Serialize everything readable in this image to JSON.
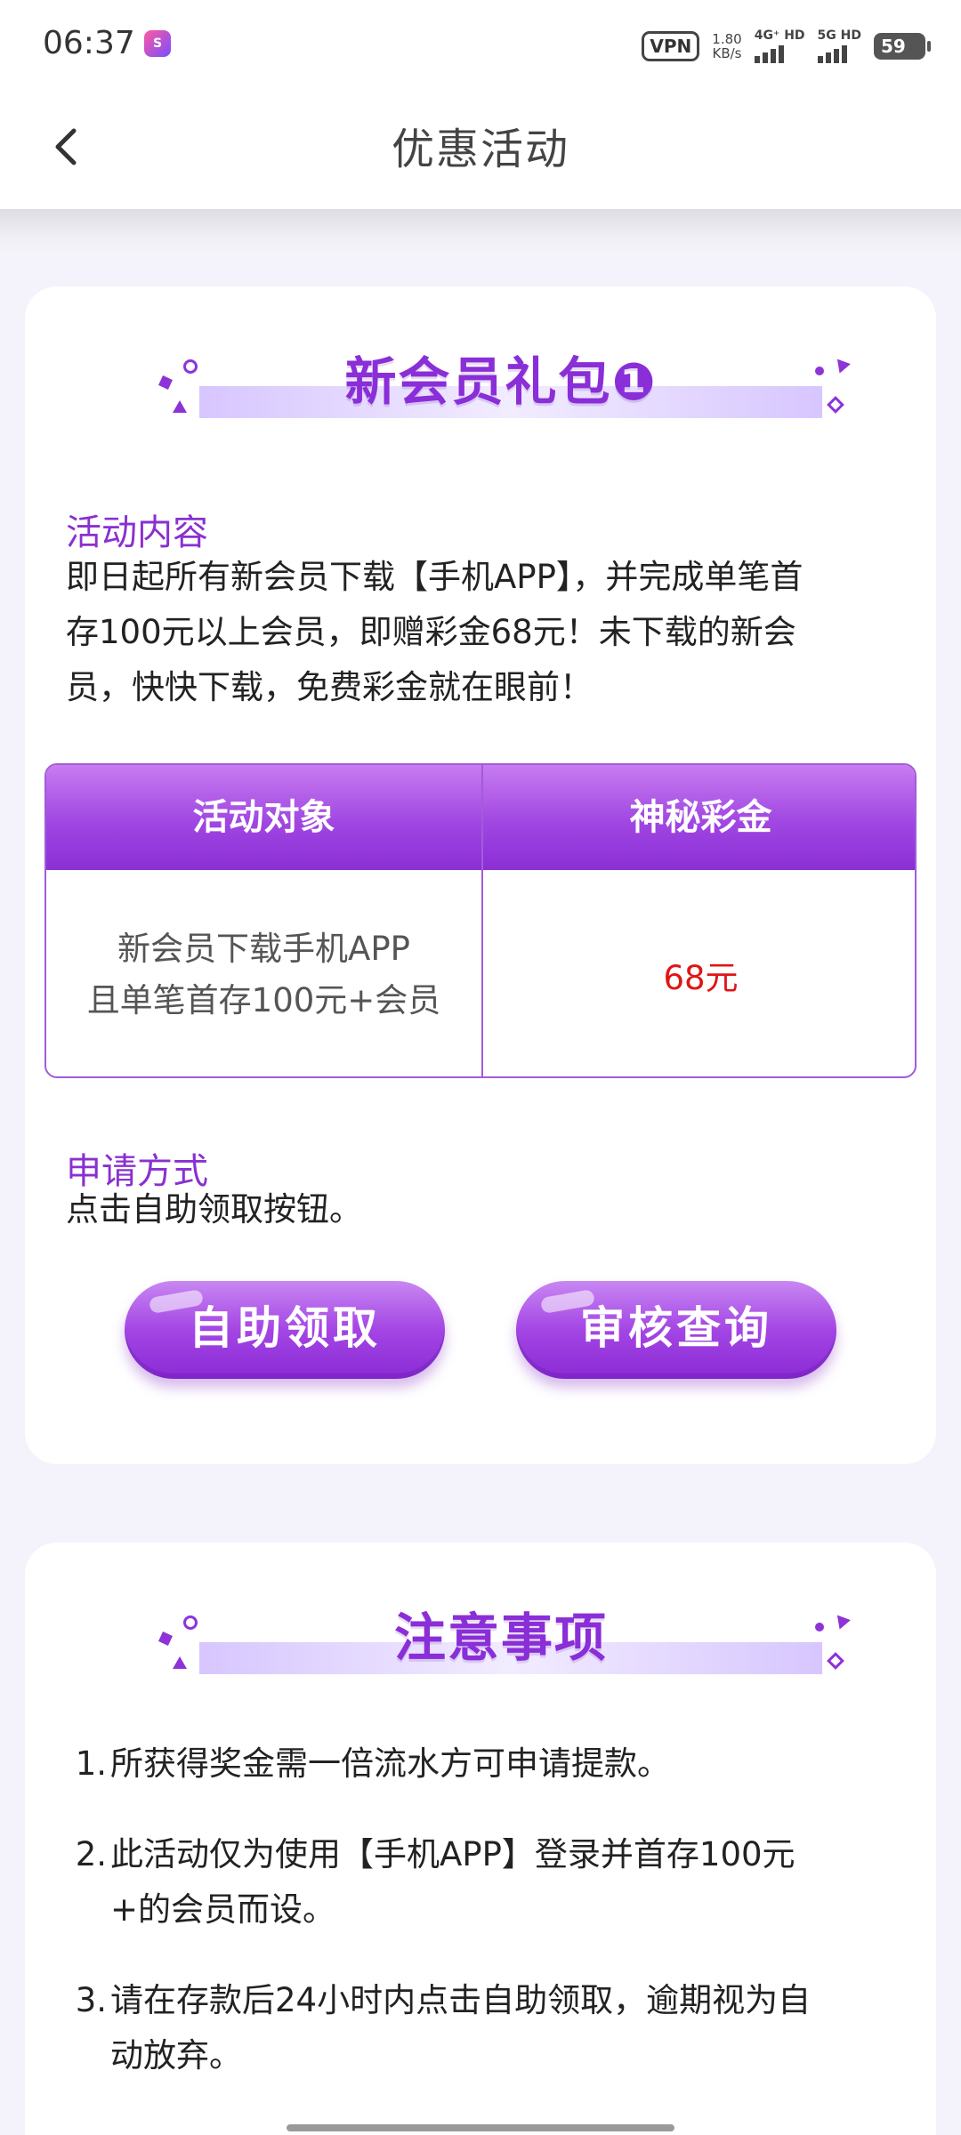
{
  "status_bar": {
    "time": "06:37",
    "app_icon": "app-badge-icon",
    "vpn": "VPN",
    "speed_value": "1.80",
    "speed_unit": "KB/s",
    "signal_1": "4G⁺ HD",
    "signal_2": "5G HD",
    "battery": "59"
  },
  "nav": {
    "back_icon": "chevron-left-icon",
    "title": "优惠活动"
  },
  "card1": {
    "banner_title": "新会员礼包❶",
    "content_label": "活动内容",
    "content_lines": [
      "即日起所有新会员下载【手机APP】，并完成单笔首",
      "存100元以上会员，即赠彩金68元！未下载的新会",
      "员，快快下载，免费彩金就在眼前！"
    ],
    "table": {
      "headers": [
        "活动对象",
        "神秘彩金"
      ],
      "row": {
        "target_lines": [
          "新会员下载手机APP",
          "且单笔首存100元+会员"
        ],
        "bonus": "68元"
      }
    },
    "apply_label": "申请方式",
    "apply_text": "点击自助领取按钮。",
    "buttons": {
      "claim": "自助领取",
      "review": "审核查询"
    }
  },
  "card2": {
    "banner_title": "注意事项",
    "notes": [
      {
        "num": "1.",
        "lines": [
          "所获得奖金需一倍流水方可申请提款。"
        ]
      },
      {
        "num": "2.",
        "lines": [
          "此活动仅为使用【手机APP】登录并首存100元",
          "+的会员而设。"
        ]
      },
      {
        "num": "3.",
        "lines": [
          "请在存款后24小时内点击自助领取，逾期视为自",
          "动放弃。"
        ]
      }
    ]
  },
  "colors": {
    "accent_purple": "#8a30d0",
    "bonus_red": "#e01515",
    "page_bg": "#f4f3fb"
  }
}
